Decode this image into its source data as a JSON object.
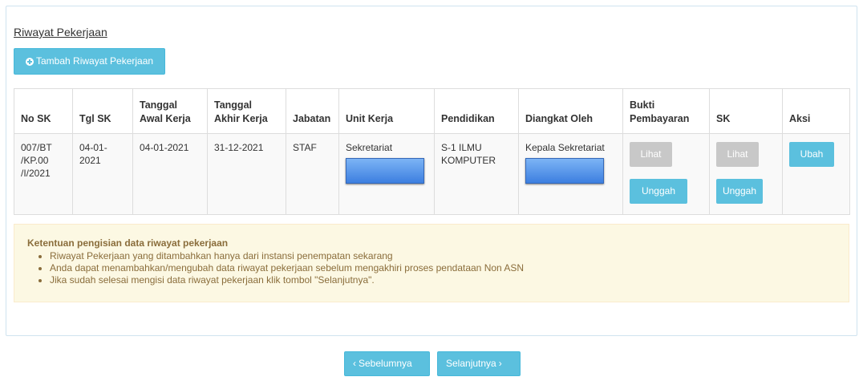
{
  "section": {
    "title": "Riwayat Pekerjaan",
    "add_button_label": "Tambah Riwayat Pekerjaan"
  },
  "table": {
    "headers": {
      "no_sk": "No SK",
      "tgl_sk": "Tgl SK",
      "tgl_awal_1": "Tanggal",
      "tgl_awal_2": "Awal Kerja",
      "tgl_akhir_1": "Tanggal",
      "tgl_akhir_2": "Akhir Kerja",
      "jabatan": "Jabatan",
      "unit_kerja": "Unit Kerja",
      "pendidikan": "Pendidikan",
      "diangkat_oleh": "Diangkat Oleh",
      "bukti_1": "Bukti",
      "bukti_2": "Pembayaran",
      "sk": "SK",
      "aksi": "Aksi"
    },
    "rows": [
      {
        "no_sk_1": "007/BT",
        "no_sk_2": "/KP.00",
        "no_sk_3": "/I/2021",
        "tgl_sk": "04-01-2021",
        "tgl_awal": "04-01-2021",
        "tgl_akhir": "31-12-2021",
        "jabatan": "STAF",
        "unit_kerja": "Sekretariat",
        "pendidikan_1": "S-1 ILMU",
        "pendidikan_2": "KOMPUTER",
        "diangkat_oleh": "Kepala Sekretariat",
        "bukti_lihat": "Lihat",
        "bukti_unggah": "Unggah",
        "sk_lihat": "Lihat",
        "sk_unggah": "Unggah",
        "aksi_ubah": "Ubah"
      }
    ]
  },
  "notice": {
    "title": "Ketentuan pengisian data riwayat pekerjaan",
    "items": [
      "Riwayat Pekerjaan yang ditambahkan hanya dari instansi penempatan sekarang",
      "Anda dapat menambahkan/mengubah data riwayat pekerjaan sebelum mengakhiri proses pendataan Non ASN",
      "Jika sudah selesai mengisi data riwayat pekerjaan klik tombol \"Selanjutnya\"."
    ]
  },
  "nav": {
    "prev_label": "Sebelumnya",
    "next_label": "Selanjutnya"
  },
  "colors": {
    "info": "#5bc0de",
    "disabled": "#c8c8c8",
    "warning_bg": "#fcf8e3",
    "warning_text": "#8a6d3b"
  }
}
